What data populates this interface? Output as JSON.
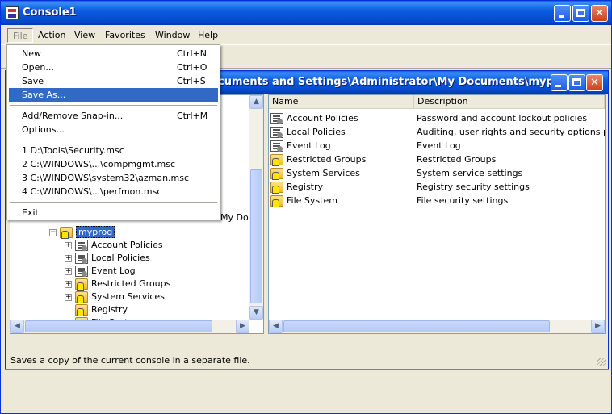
{
  "window": {
    "title": "Console1"
  },
  "menubar": [
    "File",
    "Action",
    "View",
    "Favorites",
    "Window",
    "Help"
  ],
  "file_menu": {
    "items": [
      {
        "label": "New",
        "shortcut": "Ctrl+N"
      },
      {
        "label": "Open...",
        "shortcut": "Ctrl+O"
      },
      {
        "label": "Save",
        "shortcut": "Ctrl+S"
      },
      {
        "label": "Save As...",
        "shortcut": ""
      },
      {
        "label": "Add/Remove Snap-in...",
        "shortcut": "Ctrl+M"
      },
      {
        "label": "Options...",
        "shortcut": ""
      },
      {
        "label": "1 D:\\Tools\\Security.msc",
        "shortcut": ""
      },
      {
        "label": "2 C:\\WINDOWS\\...\\compmgmt.msc",
        "shortcut": ""
      },
      {
        "label": "3 C:\\WINDOWS\\system32\\azman.msc",
        "shortcut": ""
      },
      {
        "label": "4 C:\\WINDOWS\\...\\perfmon.msc",
        "shortcut": ""
      },
      {
        "label": "Exit",
        "shortcut": ""
      }
    ]
  },
  "inner_window": {
    "title": "cuments and Settings\\Administrator\\My Documents\\myprog"
  },
  "tree": {
    "partial_parent": "My Doc",
    "root": "myprog",
    "children": [
      "Account Policies",
      "Local Policies",
      "Event Log",
      "Restricted Groups",
      "System Services",
      "Registry",
      "File System"
    ]
  },
  "list": {
    "columns": [
      "Name",
      "Description"
    ],
    "rows": [
      {
        "name": "Account Policies",
        "desc": "Password and account lockout policies"
      },
      {
        "name": "Local Policies",
        "desc": "Auditing, user rights and security options policie"
      },
      {
        "name": "Event Log",
        "desc": "Event Log"
      },
      {
        "name": "Restricted Groups",
        "desc": "Restricted Groups"
      },
      {
        "name": "System Services",
        "desc": "System service settings"
      },
      {
        "name": "Registry",
        "desc": "Registry security settings"
      },
      {
        "name": "File System",
        "desc": "File security settings"
      }
    ]
  },
  "status": {
    "text": "Saves a copy of the current console in a separate file."
  }
}
